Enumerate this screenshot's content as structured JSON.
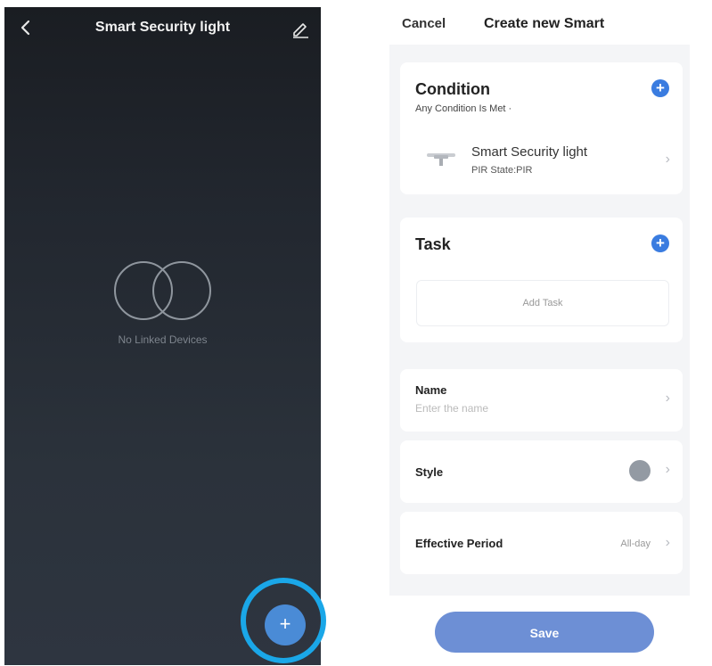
{
  "left_screen": {
    "title": "Smart Security light",
    "empty_text": "No Linked Devices",
    "fab_label": "+"
  },
  "right_screen": {
    "cancel_label": "Cancel",
    "title": "Create new Smart",
    "condition": {
      "title": "Condition",
      "subtitle": "Any Condition Is Met ·",
      "add_label": "+",
      "device_name": "Smart Security light",
      "device_state": "PIR State:PIR"
    },
    "task": {
      "title": "Task",
      "add_label": "+",
      "add_task_label": "Add Task"
    },
    "name": {
      "label": "Name",
      "placeholder": "Enter the name"
    },
    "style": {
      "label": "Style",
      "color": "#939aa3"
    },
    "effective_period": {
      "label": "Effective Period",
      "value": "All-day"
    },
    "save_label": "Save"
  },
  "colors": {
    "accent": "#3a7ce0",
    "save_button": "#6d8fd5",
    "highlight_ring": "#1aa7e8",
    "fab": "#4a8bd6"
  }
}
